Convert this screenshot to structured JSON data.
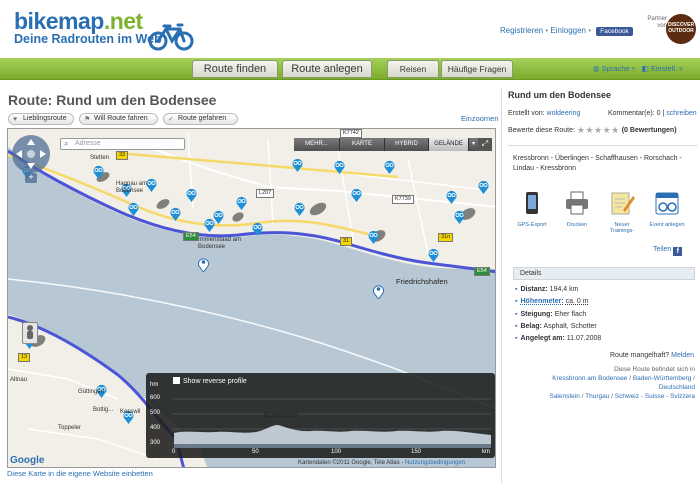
{
  "header": {
    "logo_main": "bikemap",
    "logo_tld": ".net",
    "logo_sub": "Deine Radrouten im Web",
    "register": "Registrieren",
    "login": "Einloggen",
    "facebook": "Facebook",
    "partner_label": "Partner von",
    "discover_label": "DISCOVER OUTDOOR"
  },
  "nav": {
    "tabs": [
      "Route finden",
      "Route anlegen",
      "Reisen",
      "Häufige Fragen"
    ],
    "language": "Sprache",
    "einstellungen": "Einstell."
  },
  "route": {
    "title": "Route: Rund um den Bodensee",
    "buttons": [
      "Lieblingsroute",
      "Will Route fahren",
      "Route gefahren"
    ],
    "zoom_link": "Einzoomen"
  },
  "map": {
    "search_placeholder": "Adresse",
    "types": [
      "MEHR...",
      "KARTE",
      "HYBRID",
      "GELÄNDE"
    ],
    "labels": {
      "stetten": "Stetten",
      "hagnau": "Hagnau am Bodensee",
      "immenstaad": "Immenstaad am Bodensee",
      "friedrichshafen": "Friedrichshafen",
      "bodensee": "Bodensee",
      "altnau": "Altnau",
      "bottighofen": "Bottig...",
      "kesswil": "Kesswil",
      "toppeler": "Toppeler",
      "guttingen": "Güttingen"
    },
    "roads": [
      "33",
      "K7742",
      "L207",
      "K7739",
      "31",
      "E54",
      "31n",
      "13",
      "E54"
    ],
    "google": "Google",
    "attribution": "Kartendaten ©2011 Google, Tele Atlas -",
    "terms": "Nutzungsbedingungen"
  },
  "elevation": {
    "checkbox_label": "Show reverse profile",
    "y_axis": [
      "hm",
      "600",
      "500",
      "400",
      "300"
    ],
    "x_axis": [
      "0",
      "50",
      "100",
      "150",
      "km"
    ],
    "lake_label": "Bodensee"
  },
  "embed_link": "Diese Karte in die eigene Website einbetten",
  "panel": {
    "title": "Rund um den Bodensee",
    "created_label": "Erstellt von:",
    "created_by": "woldeering",
    "comments_label": "Kommentar(e):",
    "comments_count": "0",
    "comments_write": "schreiben",
    "rate_label": "Bewerte diese Route:",
    "rate_count": "(0 Bewertungen)",
    "places": "Kressbronn - Überlingen - Schaffhausen - Rorschach - Lindau - Kressbronn",
    "actions": [
      "GPS-Export",
      "Drucken",
      "Neuer Trainings-",
      "Event anlegen"
    ],
    "share": "Teilen",
    "details_header": "Details",
    "distance_label": "Distanz:",
    "distance_value": "194,4 km",
    "altitude_label": "Höhenmeter:",
    "altitude_value": "ca. 0 m",
    "climb_label": "Steigung:",
    "climb_value": "Eher flach",
    "surface_label": "Belag:",
    "surface_value": "Asphalt, Schotter",
    "created_date_label": "Angelegt am:",
    "created_date_value": "11.07.2008",
    "defect_q": "Route mangelhaft?",
    "defect_link": "Melden",
    "located_intro": "Diese Route befindet sich in",
    "loc1": "Kressbronn am Bodensee",
    "loc2": "Baden-Württemberg",
    "loc3": "Deutschland",
    "loc4": "Salenstein",
    "loc5": "Thurgau",
    "loc6": "Schweiz - Suisse - Svizzera"
  },
  "colors": {
    "brand_blue": "#2b6fb3",
    "brand_green": "#7bb32e",
    "route_line": "#4b55d6",
    "lake": "#b7c8d4"
  }
}
